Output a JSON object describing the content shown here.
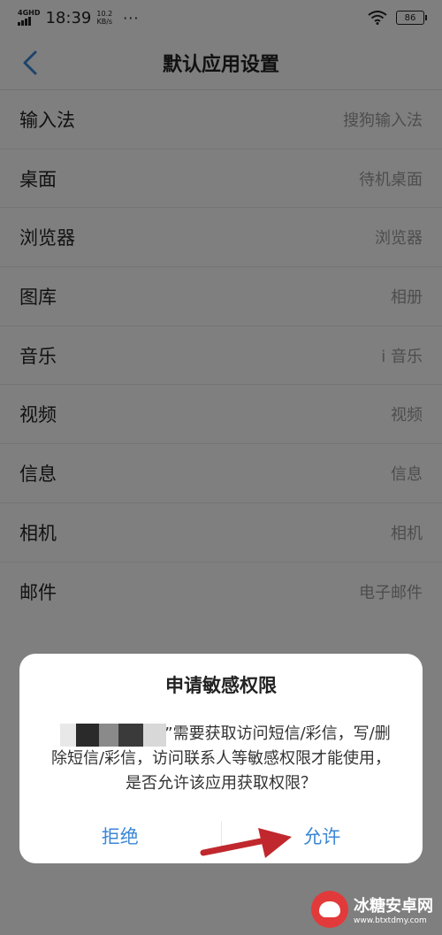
{
  "status_bar": {
    "network": "4G",
    "hd": "HD",
    "time": "18:39",
    "speed_value": "10.2",
    "speed_unit": "KB/s",
    "more": "···",
    "battery": "86"
  },
  "header": {
    "title": "默认应用设置",
    "back_icon": "chevron-left-icon"
  },
  "settings": {
    "rows": [
      {
        "label": "输入法",
        "value": "搜狗输入法"
      },
      {
        "label": "桌面",
        "value": "待机桌面"
      },
      {
        "label": "浏览器",
        "value": "浏览器"
      },
      {
        "label": "图库",
        "value": "相册"
      },
      {
        "label": "音乐",
        "value": "i 音乐"
      },
      {
        "label": "视频",
        "value": "视频"
      },
      {
        "label": "信息",
        "value": "信息"
      },
      {
        "label": "相机",
        "value": "相机"
      },
      {
        "label": "邮件",
        "value": "电子邮件"
      }
    ]
  },
  "dialog": {
    "title": "申请敏感权限",
    "message": "”需要获取访问短信/彩信，写/删除短信/彩信，访问联系人等敏感权限才能使用，是否允许该应用获取权限？",
    "deny_label": "拒绝",
    "allow_label": "允许"
  },
  "watermark": {
    "name": "冰糖安卓网",
    "url": "www.btxtdmy.com"
  },
  "colors": {
    "accent": "#3a86d6",
    "overlay": "rgba(0,0,0,0.5)",
    "arrow": "#c0282d"
  }
}
